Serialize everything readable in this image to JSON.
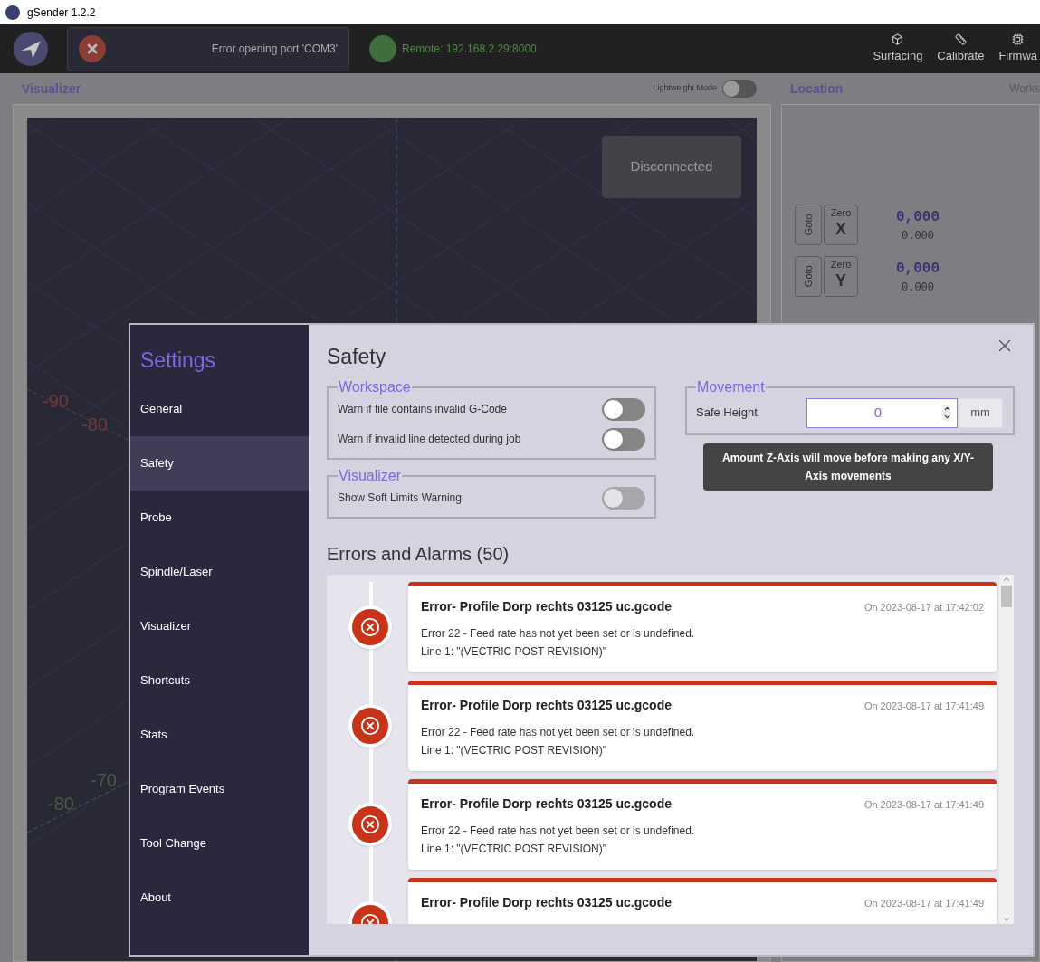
{
  "window": {
    "title": "gSender 1.2.2"
  },
  "header": {
    "notification": {
      "kind": "error",
      "message": "Error opening port 'COM3'"
    },
    "remote": {
      "label": "Remote: 192.168.2.29:8000"
    },
    "nav": [
      {
        "label": "Surfacing"
      },
      {
        "label": "Calibrate"
      },
      {
        "label": "Firmwa"
      }
    ]
  },
  "visualizer": {
    "title": "Visualizer",
    "lightweight_mode": {
      "label": "Lightweight Mode",
      "on": false
    },
    "status": "Disconnected",
    "axis_labels": [
      {
        "text": "-90",
        "kind": "x"
      },
      {
        "text": "-80",
        "kind": "x"
      },
      {
        "text": "-70",
        "kind": "y"
      },
      {
        "text": "-80",
        "kind": "y"
      }
    ]
  },
  "location": {
    "title": "Location",
    "column_2": "Works",
    "axes": [
      {
        "goto": "Goto",
        "zero": "Zero",
        "axis": "X",
        "value": "0,000",
        "machine": "0.000"
      },
      {
        "goto": "Goto",
        "zero": "Zero",
        "axis": "Y",
        "value": "0,000",
        "machine": "0.000"
      }
    ]
  },
  "settings": {
    "title": "Settings",
    "items": [
      {
        "label": "General",
        "selected": false
      },
      {
        "label": "Safety",
        "selected": true
      },
      {
        "label": "Probe",
        "selected": false
      },
      {
        "label": "Spindle/Laser",
        "selected": false
      },
      {
        "label": "Visualizer",
        "selected": false
      },
      {
        "label": "Shortcuts",
        "selected": false
      },
      {
        "label": "Stats",
        "selected": false
      },
      {
        "label": "Program Events",
        "selected": false
      },
      {
        "label": "Tool Change",
        "selected": false
      },
      {
        "label": "About",
        "selected": false
      }
    ],
    "page_title": "Safety",
    "groups": [
      {
        "title": "Workspace",
        "toggles": [
          {
            "label": "Warn if file contains invalid G-Code",
            "on": false,
            "disabled": false
          },
          {
            "label": "Warn if invalid line detected during job",
            "on": false,
            "disabled": false
          }
        ]
      },
      {
        "title": "Visualizer",
        "toggles": [
          {
            "label": "Show Soft Limits Warning",
            "on": false,
            "disabled": true
          }
        ]
      }
    ],
    "movement": {
      "title": "Movement",
      "label": "Safe Height",
      "value": "0",
      "unit": "mm",
      "tooltip": "Amount Z-Axis will move before making any X/Y-Axis movements"
    },
    "errors": {
      "title": "Errors and Alarms (50)",
      "items": [
        {
          "title": "Error- Profile Dorp rechts 03125 uc.gcode",
          "date": "On 2023-08-17 at 17:42:02",
          "message": "Error 22 - Feed rate has not yet been set or is undefined.",
          "line": "Line 1: \"(VECTRIC POST REVISION)\""
        },
        {
          "title": "Error- Profile Dorp rechts 03125 uc.gcode",
          "date": "On 2023-08-17 at 17:41:49",
          "message": "Error 22 - Feed rate has not yet been set or is undefined.",
          "line": "Line 1: \"(VECTRIC POST REVISION)\""
        },
        {
          "title": "Error- Profile Dorp rechts 03125 uc.gcode",
          "date": "On 2023-08-17 at 17:41:49",
          "message": "Error 22 - Feed rate has not yet been set or is undefined.",
          "line": "Line 1: \"(VECTRIC POST REVISION)\""
        },
        {
          "title": "Error- Profile Dorp rechts 03125 uc.gcode",
          "date": "On 2023-08-17 at 17:41:49"
        }
      ]
    }
  }
}
